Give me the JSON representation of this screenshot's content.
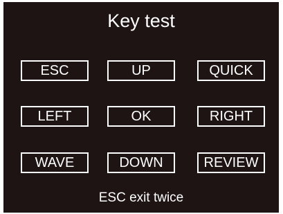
{
  "title": "Key test",
  "keys": {
    "esc": "ESC",
    "up": "UP",
    "quick": "QUICK",
    "left": "LEFT",
    "ok": "OK",
    "right": "RIGHT",
    "wave": "WAVE",
    "down": "DOWN",
    "review": "REVIEW"
  },
  "footer": "ESC exit twice",
  "colors": {
    "background": "#1e1414",
    "foreground": "#ffffff"
  }
}
